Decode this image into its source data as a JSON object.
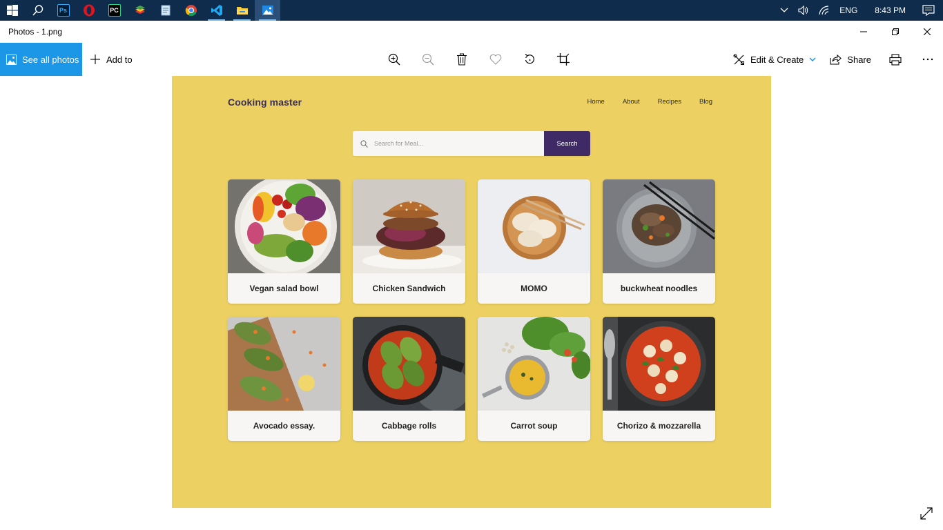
{
  "taskbar": {
    "start_icon": "windows-logo",
    "apps": [
      {
        "name": "search",
        "icon": "search-icon"
      },
      {
        "name": "photoshop",
        "icon": "photoshop-icon",
        "badge": "Ps"
      },
      {
        "name": "opera",
        "icon": "opera-icon"
      },
      {
        "name": "pycharm",
        "icon": "pycharm-icon",
        "badge": "PC"
      },
      {
        "name": "bluestacks",
        "icon": "bluestacks-icon"
      },
      {
        "name": "notepad",
        "icon": "notepad-icon"
      },
      {
        "name": "chrome",
        "icon": "chrome-icon"
      },
      {
        "name": "vscode",
        "icon": "vscode-icon"
      },
      {
        "name": "file-explorer",
        "icon": "folder-icon"
      },
      {
        "name": "photos",
        "icon": "photos-icon"
      }
    ],
    "tray": {
      "language": "ENG",
      "time": "8:43 PM"
    }
  },
  "window": {
    "title": "Photos - 1.png"
  },
  "toolbar": {
    "see_all_label": "See all photos",
    "add_to_label": "Add to",
    "edit_create_label": "Edit & Create",
    "share_label": "Share"
  },
  "site": {
    "logo": "Cooking master",
    "nav": [
      "Home",
      "About",
      "Recipes",
      "Blog"
    ],
    "search_placeholder": "Search for Meal...",
    "search_button": "Search",
    "meals": [
      {
        "name": "Vegan salad bowl"
      },
      {
        "name": "Chicken Sandwich"
      },
      {
        "name": "MOMO"
      },
      {
        "name": "buckwheat noodles"
      },
      {
        "name": "Avocado essay."
      },
      {
        "name": "Cabbage rolls"
      },
      {
        "name": "Carrot soup"
      },
      {
        "name": "Chorizo & mozzarella"
      }
    ]
  },
  "colors": {
    "taskbar": "#0f2c4c",
    "accent": "#1c96e6",
    "canvas": "#ecd061",
    "search_button": "#3f2a66",
    "logo_text": "#3b2f55"
  }
}
